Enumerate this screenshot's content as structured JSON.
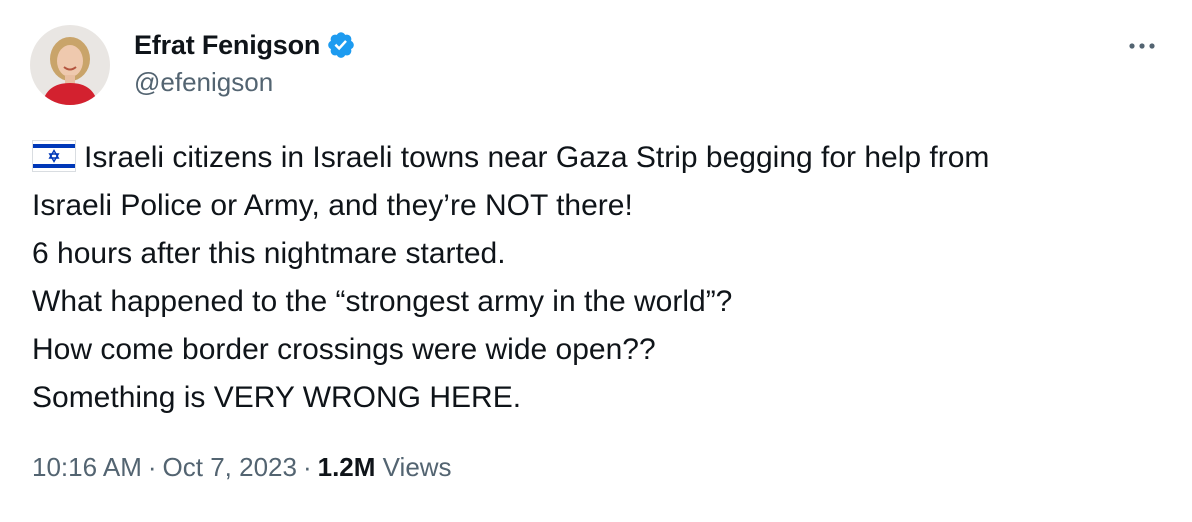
{
  "author": {
    "display_name": "Efrat Fenigson",
    "handle": "@efenigson",
    "verified": true,
    "avatar_icon": "profile-photo"
  },
  "tweet": {
    "flag_icon": "israel-flag-icon",
    "lines": [
      "Israeli citizens in Israeli towns near Gaza Strip begging for help from",
      "Israeli Police or Army, and they’re NOT there!",
      "6 hours after this nightmare started.",
      "What happened to the “strongest army in the world”?",
      "How come border crossings were wide open??",
      "Something is VERY WRONG HERE."
    ]
  },
  "meta": {
    "time": "10:16 AM",
    "separator": "·",
    "date": "Oct 7, 2023",
    "views_count": "1.2M",
    "views_label": "Views"
  },
  "colors": {
    "text_primary": "#0f1419",
    "text_secondary": "#536471",
    "verified_blue": "#1d9bf0",
    "flag_blue": "#0038b8"
  }
}
